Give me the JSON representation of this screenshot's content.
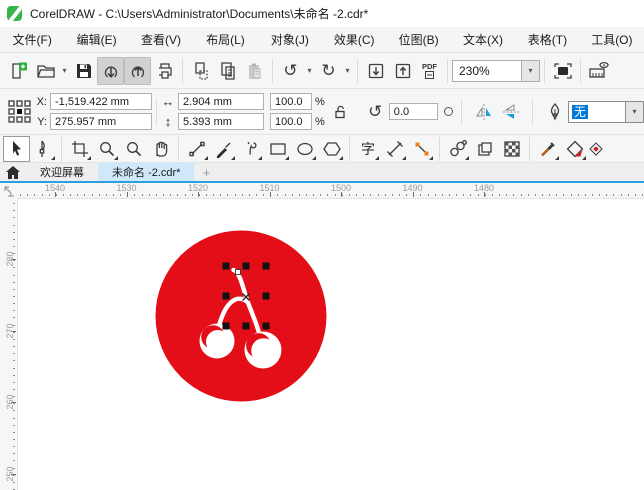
{
  "window": {
    "title": "CorelDRAW - C:\\Users\\Administrator\\Documents\\未命名 -2.cdr*"
  },
  "menu": {
    "items": [
      "文件(F)",
      "编辑(E)",
      "查看(V)",
      "布局(L)",
      "对象(J)",
      "效果(C)",
      "位图(B)",
      "文本(X)",
      "表格(T)",
      "工具(O)"
    ]
  },
  "toolbar": {
    "zoom_level": "230%",
    "pdf_label": "PDF",
    "undo_glyph": "↺",
    "redo_glyph": "↻",
    "import_glyph": "↓",
    "export_glyph": "↑",
    "caret_glyph": "▾"
  },
  "property_bar": {
    "x_label": "X:",
    "y_label": "Y:",
    "x_value": "-1,519.422 mm",
    "y_value": "275.957 mm",
    "width_glyph": "↔",
    "height_glyph": "↕",
    "width_value": "2.904 mm",
    "height_value": "5.393 mm",
    "scale_x": "100.0",
    "scale_y": "100.0",
    "percent": "%",
    "rotate_glyph": "↺",
    "angle_value": "0.0",
    "outline_width": "无",
    "caret_glyph": "▾"
  },
  "toolbox": {
    "text_tool_glyph": "字"
  },
  "tabs": {
    "welcome_label": "欢迎屏幕",
    "document_label": "未命名 -2.cdr*",
    "new_tab_label": "+"
  },
  "ruler": {
    "horizontal_labels": [
      "1540",
      "1530",
      "1520",
      "1510",
      "1500",
      "1490",
      "1480"
    ],
    "vertical_labels": [
      "280",
      "270",
      "260",
      "250"
    ],
    "h_label_start": 37,
    "v_label_start": 60,
    "label_spacing": 71.5,
    "minor_step": 7.15
  },
  "canvas": {
    "logo_color": "#e30e18",
    "selection_handle_color": "#111111"
  },
  "colors": {
    "accent_blue": "#2b9fe0",
    "selection_highlight": "#0078d7",
    "mirror_icon_blue": "#1e9cd7"
  }
}
